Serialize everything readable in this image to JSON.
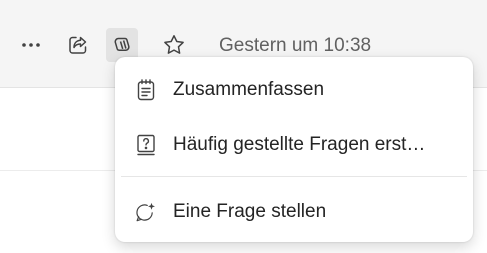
{
  "toolbar": {
    "more_icon": "ellipsis-icon",
    "share_icon": "share-icon",
    "copilot_icon": "copilot-icon",
    "favorite_icon": "star-icon",
    "timestamp": "Gestern um 10:38",
    "active_button_bg": "#e3e3e3",
    "background": "#f5f5f5"
  },
  "copilot_menu": {
    "items": [
      {
        "label": "Zusammenfassen",
        "icon": "summary-notes-icon"
      },
      {
        "label": "Häufig gestellte Fragen erst…",
        "icon": "faq-question-icon"
      },
      {
        "label": "Eine Frage stellen",
        "icon": "chat-sparkle-icon"
      }
    ]
  }
}
